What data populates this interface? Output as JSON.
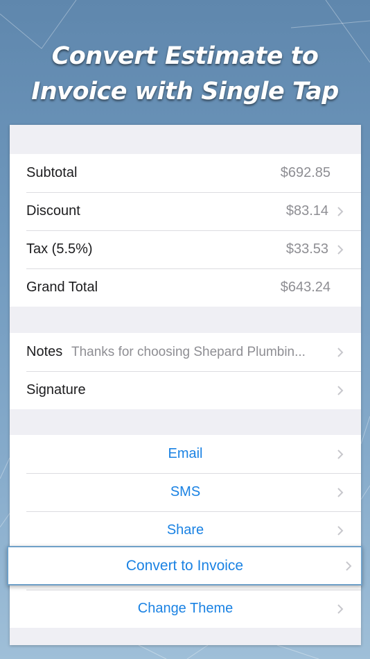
{
  "headline": {
    "line1": "Convert Estimate to",
    "line2": "Invoice with Single Tap"
  },
  "totals": {
    "subtotal": {
      "label": "Subtotal",
      "value": "$692.85"
    },
    "discount": {
      "label": "Discount",
      "value": "$83.14"
    },
    "tax": {
      "label": "Tax (5.5%)",
      "value": "$33.53"
    },
    "grand_total": {
      "label": "Grand Total",
      "value": "$643.24"
    }
  },
  "details": {
    "notes": {
      "label": "Notes",
      "value": "Thanks for choosing Shepard Plumbin..."
    },
    "signature": {
      "label": "Signature"
    }
  },
  "actions": {
    "email": "Email",
    "sms": "SMS",
    "share": "Share",
    "convert": "Convert to Invoice",
    "change_theme": "Change Theme"
  },
  "colors": {
    "accent": "#1a82e3",
    "value_gray": "#8e8e93",
    "group_background": "#efeff4"
  },
  "icons": {
    "chevron": "chevron-right-icon"
  }
}
